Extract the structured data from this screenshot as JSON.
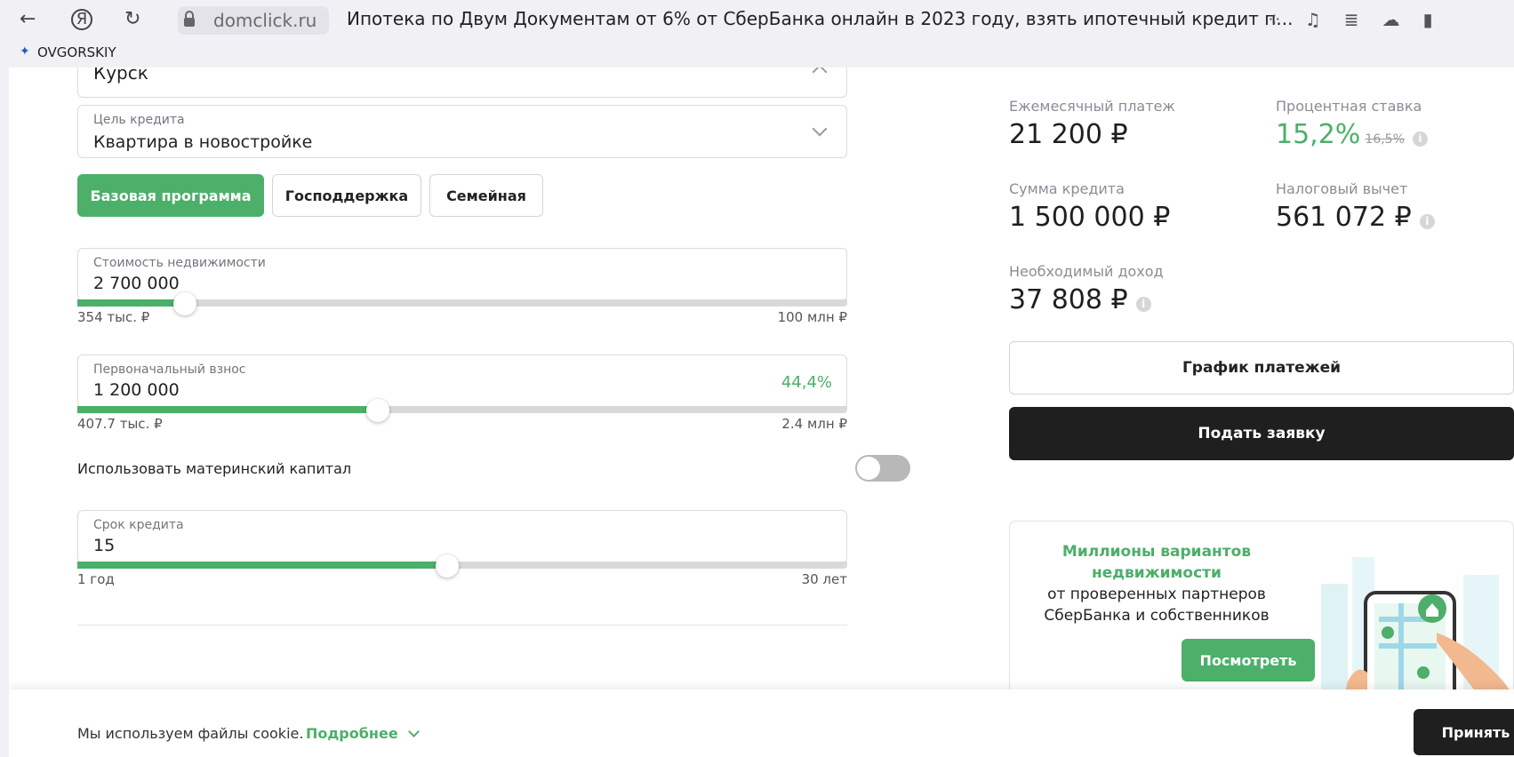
{
  "browser": {
    "back_icon": "arrow-left-icon",
    "yandex_icon": "Я",
    "reload_icon": "reload-icon",
    "domain": "domclick.ru",
    "title": "Ипотека по Двум Документам от 6% от СберБанка онлайн в 2023 году, взять ипотечный кредит п..."
  },
  "bookmarks": {
    "label": "OVGORSKIY"
  },
  "form": {
    "city_value": "Курск",
    "goal_label": "Цель кредита",
    "goal_value": "Квартира в новостройке",
    "programs": [
      "Базовая программа",
      "Господдержка",
      "Семейная"
    ],
    "property": {
      "label": "Стоимость недвижимости",
      "value": "2 700 000",
      "min": "354 тыс. ₽",
      "max": "100 млн ₽",
      "progress": 0.14
    },
    "downpayment": {
      "label": "Первоначальный взнос",
      "value": "1 200 000",
      "percent": "44,4%",
      "min": "407.7 тыс. ₽",
      "max": "2.4 млн ₽",
      "progress": 0.39
    },
    "maternity": {
      "label": "Использовать материнский капитал",
      "enabled": false
    },
    "term": {
      "label": "Срок кредита",
      "value": "15",
      "min": "1 год",
      "max": "30 лет",
      "progress": 0.48
    }
  },
  "summary": {
    "monthly_label": "Ежемесячный платеж",
    "monthly_value": "21 200 ₽",
    "rate_label": "Процентная ставка",
    "rate_value": "15,2%",
    "rate_old": "16,5%",
    "loan_label": "Сумма кредита",
    "loan_value": "1 500 000 ₽",
    "tax_label": "Налоговый вычет",
    "tax_value": "561 072 ₽",
    "income_label": "Необходимый доход",
    "income_value": "37 808 ₽",
    "schedule_button": "График платежей",
    "apply_button": "Подать заявку"
  },
  "promo": {
    "line1": "Миллионы вариантов",
    "line2": "недвижимости",
    "line3": "от проверенных партнеров",
    "line4": "СберБанка и собственников",
    "button": "Посмотреть"
  },
  "cookie": {
    "text": "Мы используем файлы cookie.",
    "more": "Подробнее",
    "accept": "Принять"
  },
  "colors": {
    "accent": "#4caf6a",
    "dark": "#1f1f1f"
  }
}
